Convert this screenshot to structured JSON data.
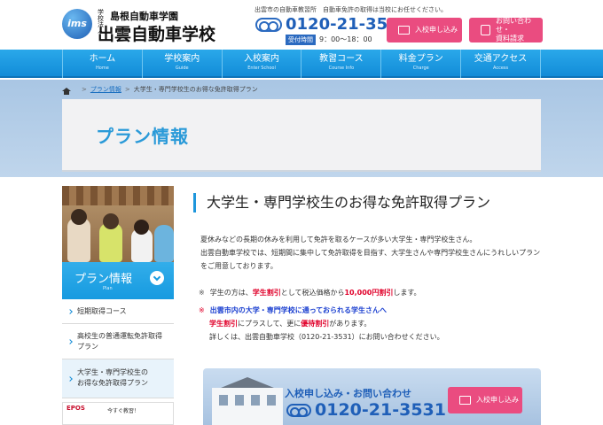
{
  "header": {
    "logo_mark": "ims",
    "logo_small": "学校法人",
    "logo_sub": "島根自動車学園",
    "logo_main": "出雲自動車学校",
    "note": "出雲市の自動車教習所　自動車免許の取得は当校にお任せください。",
    "phone": "0120-21-3531",
    "hours_label": "受付時間",
    "hours_value": "9：00～18：00",
    "apply_button": "入校申し込み",
    "inquiry_line1": "お問い合わせ・",
    "inquiry_line2": "資料請求"
  },
  "nav": [
    {
      "label": "ホーム",
      "sub": "Home"
    },
    {
      "label": "学校案内",
      "sub": "Guide"
    },
    {
      "label": "入校案内",
      "sub": "Enter School"
    },
    {
      "label": "教習コース",
      "sub": "Course Info"
    },
    {
      "label": "料金プラン",
      "sub": "Charge"
    },
    {
      "label": "交通アクセス",
      "sub": "Access"
    }
  ],
  "breadcrumb": {
    "link": "プラン情報",
    "current": "大学生・専門学校生のお得な免許取得プラン"
  },
  "page_title": "プラン情報",
  "sidebar": {
    "heading": "プラン情報",
    "heading_sub": "Plan",
    "items": [
      {
        "line1": "短期取得コース",
        "line2": ""
      },
      {
        "line1": "高校生の普通運転免許取得",
        "line2": "プラン"
      },
      {
        "line1": "大学生・専門学校生の",
        "line2": "お得な免許取得プラン"
      }
    ],
    "banner_logo": "EPOS",
    "banner_text": "今すぐ教習！"
  },
  "content": {
    "title": "大学生・専門学校生のお得な免許取得プラン",
    "para_line1": "夏休みなどの長期の休みを利用して免許を取るケースが多い大学生・専門学校生さん。",
    "para_line2": "出雲自動車学校では、短期間に集中して免許取得を目指す、大学生さんや専門学校生さんにうれしいプラン",
    "para_line3": "をご用意しております。",
    "note1_mark": "※",
    "note1_pre": "学生の方は、",
    "note1_red1": "学生割引",
    "note1_mid": "として税込価格から",
    "note1_red2": "10,000円割引",
    "note1_post": "します。",
    "note2_mark": "※",
    "note2_blue": "出雲市内の大学・専門学校に通っておられる学生さんへ",
    "note3_red1": "学生割引",
    "note3_mid": "にプラスして、更に",
    "note3_red2": "優待割引",
    "note3_post": "があります。",
    "note4": "詳しくは、出雲自動車学校（0120-21-3531）にお問い合わせください。"
  },
  "contact_box": {
    "title": "入校申し込み・お問い合わせ",
    "phone": "0120-21-3531",
    "button": "入校申し込み"
  }
}
